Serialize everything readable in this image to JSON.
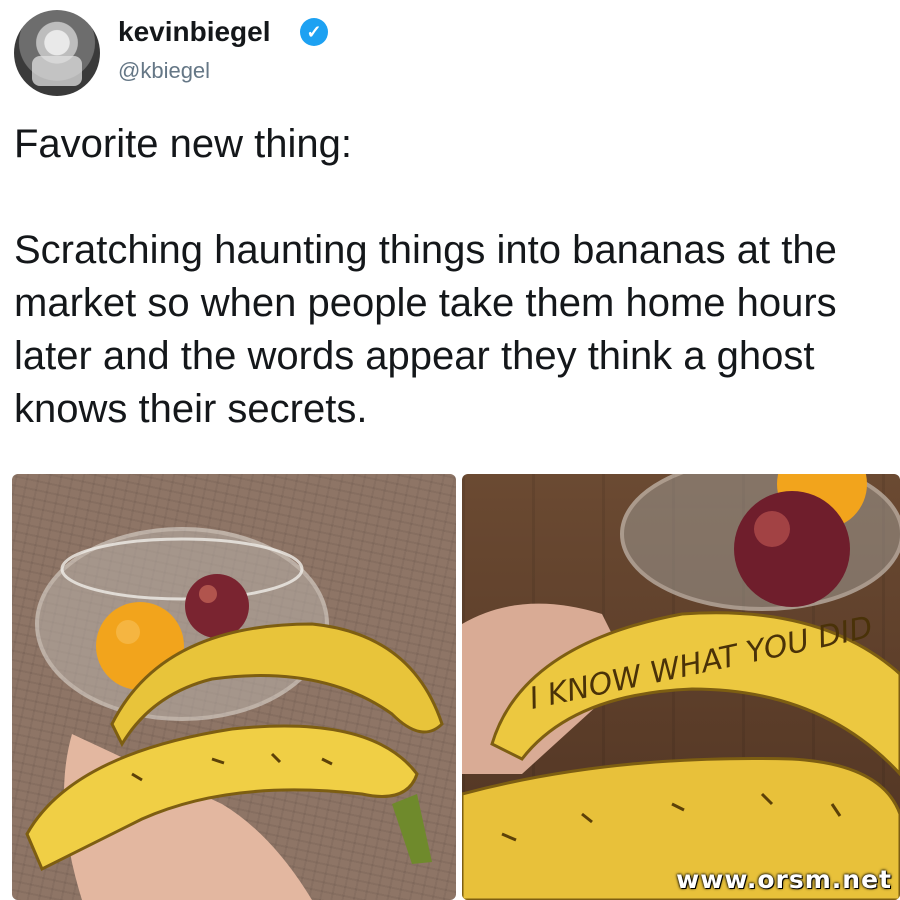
{
  "tweet": {
    "display_name": "kevinbiegel",
    "handle": "@kbiegel",
    "verified_icon": "verified-badge-icon",
    "text": "Favorite new thing:\n\nScratching haunting things into bananas at the market so when people take them home hours later and the words appear they think a ghost knows their secrets."
  },
  "photos": {
    "left_alt_icon": "bananas-in-bowl-photo",
    "right_alt_icon": "scratched-banana-photo",
    "scratched_words": "I KNOW WHAT YOU DID"
  },
  "watermark": "www.orsm.net",
  "colors": {
    "verified": "#1da1f2",
    "handle": "#657786",
    "text": "#14171a"
  }
}
